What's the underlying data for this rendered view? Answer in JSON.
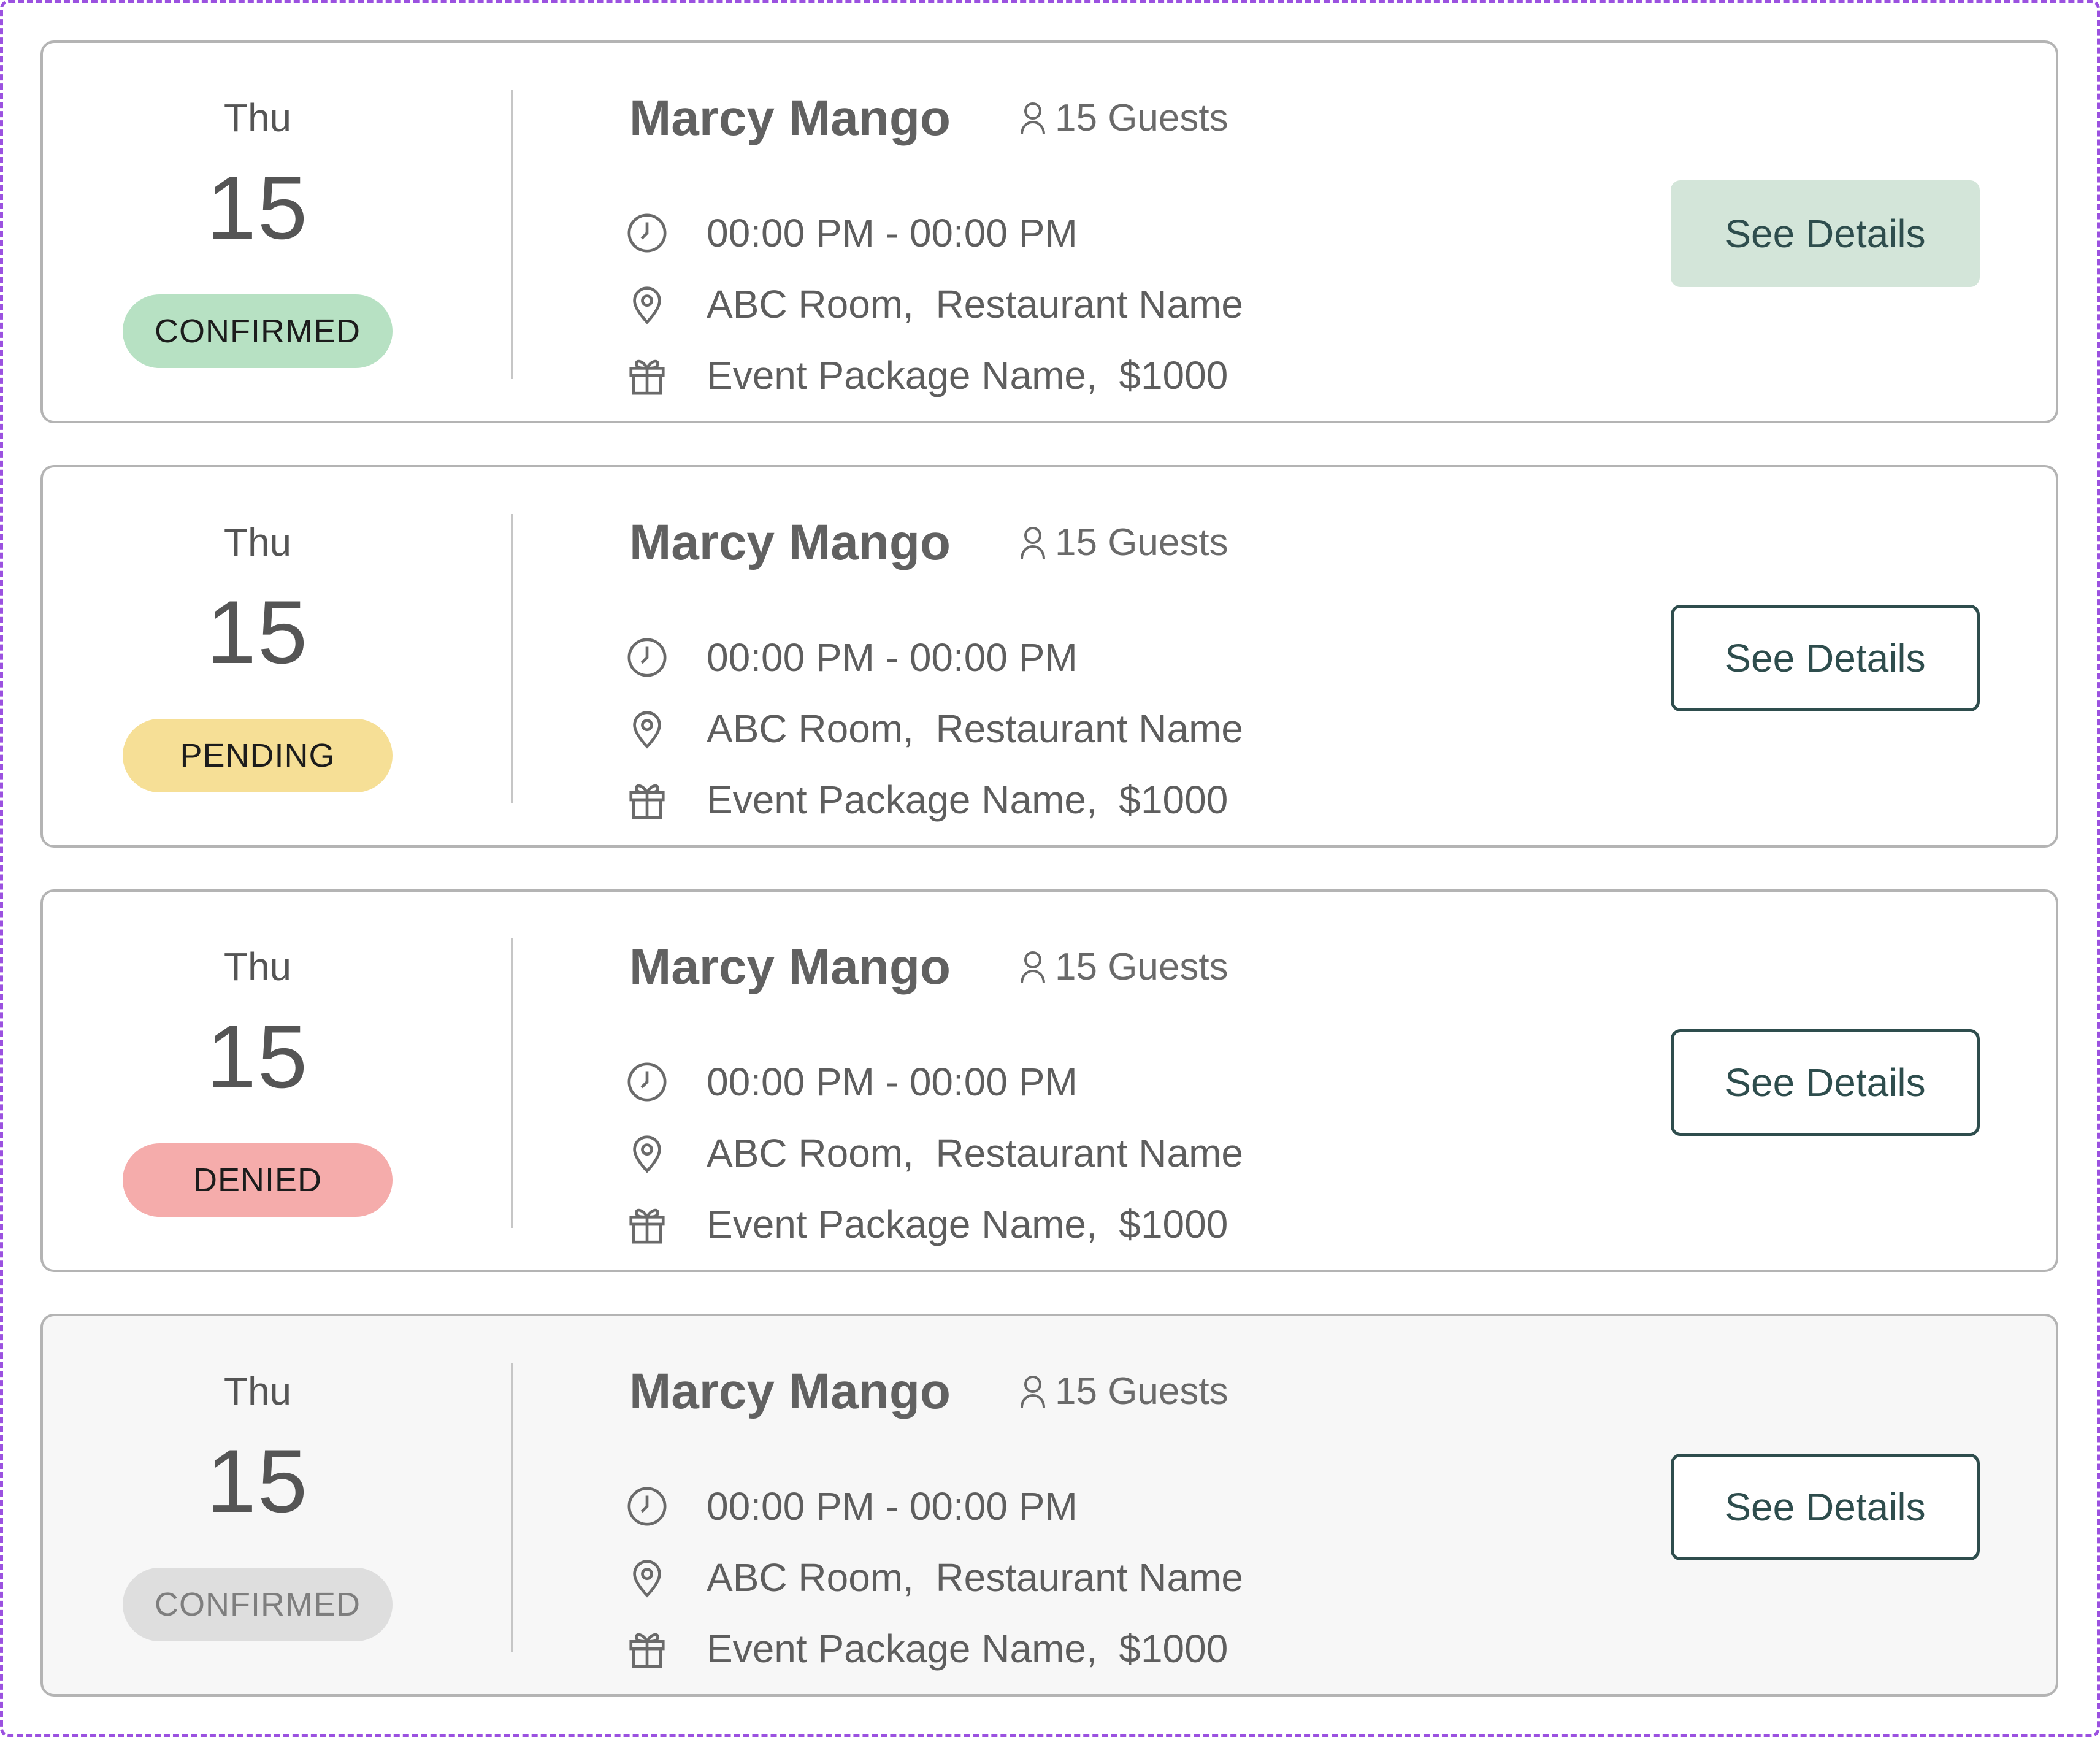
{
  "colors": {
    "frame_dash": "#9b51e0",
    "card_border": "#b4b4b4",
    "card_muted_bg": "#f7f7f7",
    "text_gray": "#5e5e5e",
    "button_teal": "#2e4d4d",
    "button_filled_bg": "#d3e5d9"
  },
  "status_colors": {
    "confirmed": {
      "bg": "#b7e1c3",
      "text": "#1c1c1c"
    },
    "pending": {
      "bg": "#f6df96",
      "text": "#1c1c1c"
    },
    "denied": {
      "bg": "#f5acab",
      "text": "#1c1c1c"
    },
    "confirmed_muted": {
      "bg": "#dedede",
      "text": "#7e7e7e"
    }
  },
  "bookings": [
    {
      "weekday": "Thu",
      "day": "15",
      "status": "CONFIRMED",
      "name": "Marcy Mango",
      "guests": "15 Guests",
      "time": "00:00 PM - 00:00 PM",
      "location": "ABC Room,  Restaurant Name",
      "package": "Event Package Name,  $1000",
      "button_label": "See Details",
      "icons": {
        "guests": "person-icon",
        "time": "clock-icon",
        "location": "map-pin-icon",
        "package": "gift-icon"
      }
    },
    {
      "weekday": "Thu",
      "day": "15",
      "status": "PENDING",
      "name": "Marcy Mango",
      "guests": "15 Guests",
      "time": "00:00 PM - 00:00 PM",
      "location": "ABC Room,  Restaurant Name",
      "package": "Event Package Name,  $1000",
      "button_label": "See Details",
      "icons": {
        "guests": "person-icon",
        "time": "clock-icon",
        "location": "map-pin-icon",
        "package": "gift-icon"
      }
    },
    {
      "weekday": "Thu",
      "day": "15",
      "status": "DENIED",
      "name": "Marcy Mango",
      "guests": "15 Guests",
      "time": "00:00 PM - 00:00 PM",
      "location": "ABC Room,  Restaurant Name",
      "package": "Event Package Name,  $1000",
      "button_label": "See Details",
      "icons": {
        "guests": "person-icon",
        "time": "clock-icon",
        "location": "map-pin-icon",
        "package": "gift-icon"
      }
    },
    {
      "weekday": "Thu",
      "day": "15",
      "status": "CONFIRMED",
      "name": "Marcy Mango",
      "guests": "15 Guests",
      "time": "00:00 PM - 00:00 PM",
      "location": "ABC Room,  Restaurant Name",
      "package": "Event Package Name,  $1000",
      "button_label": "See Details",
      "icons": {
        "guests": "person-icon",
        "time": "clock-icon",
        "location": "map-pin-icon",
        "package": "gift-icon"
      }
    }
  ]
}
